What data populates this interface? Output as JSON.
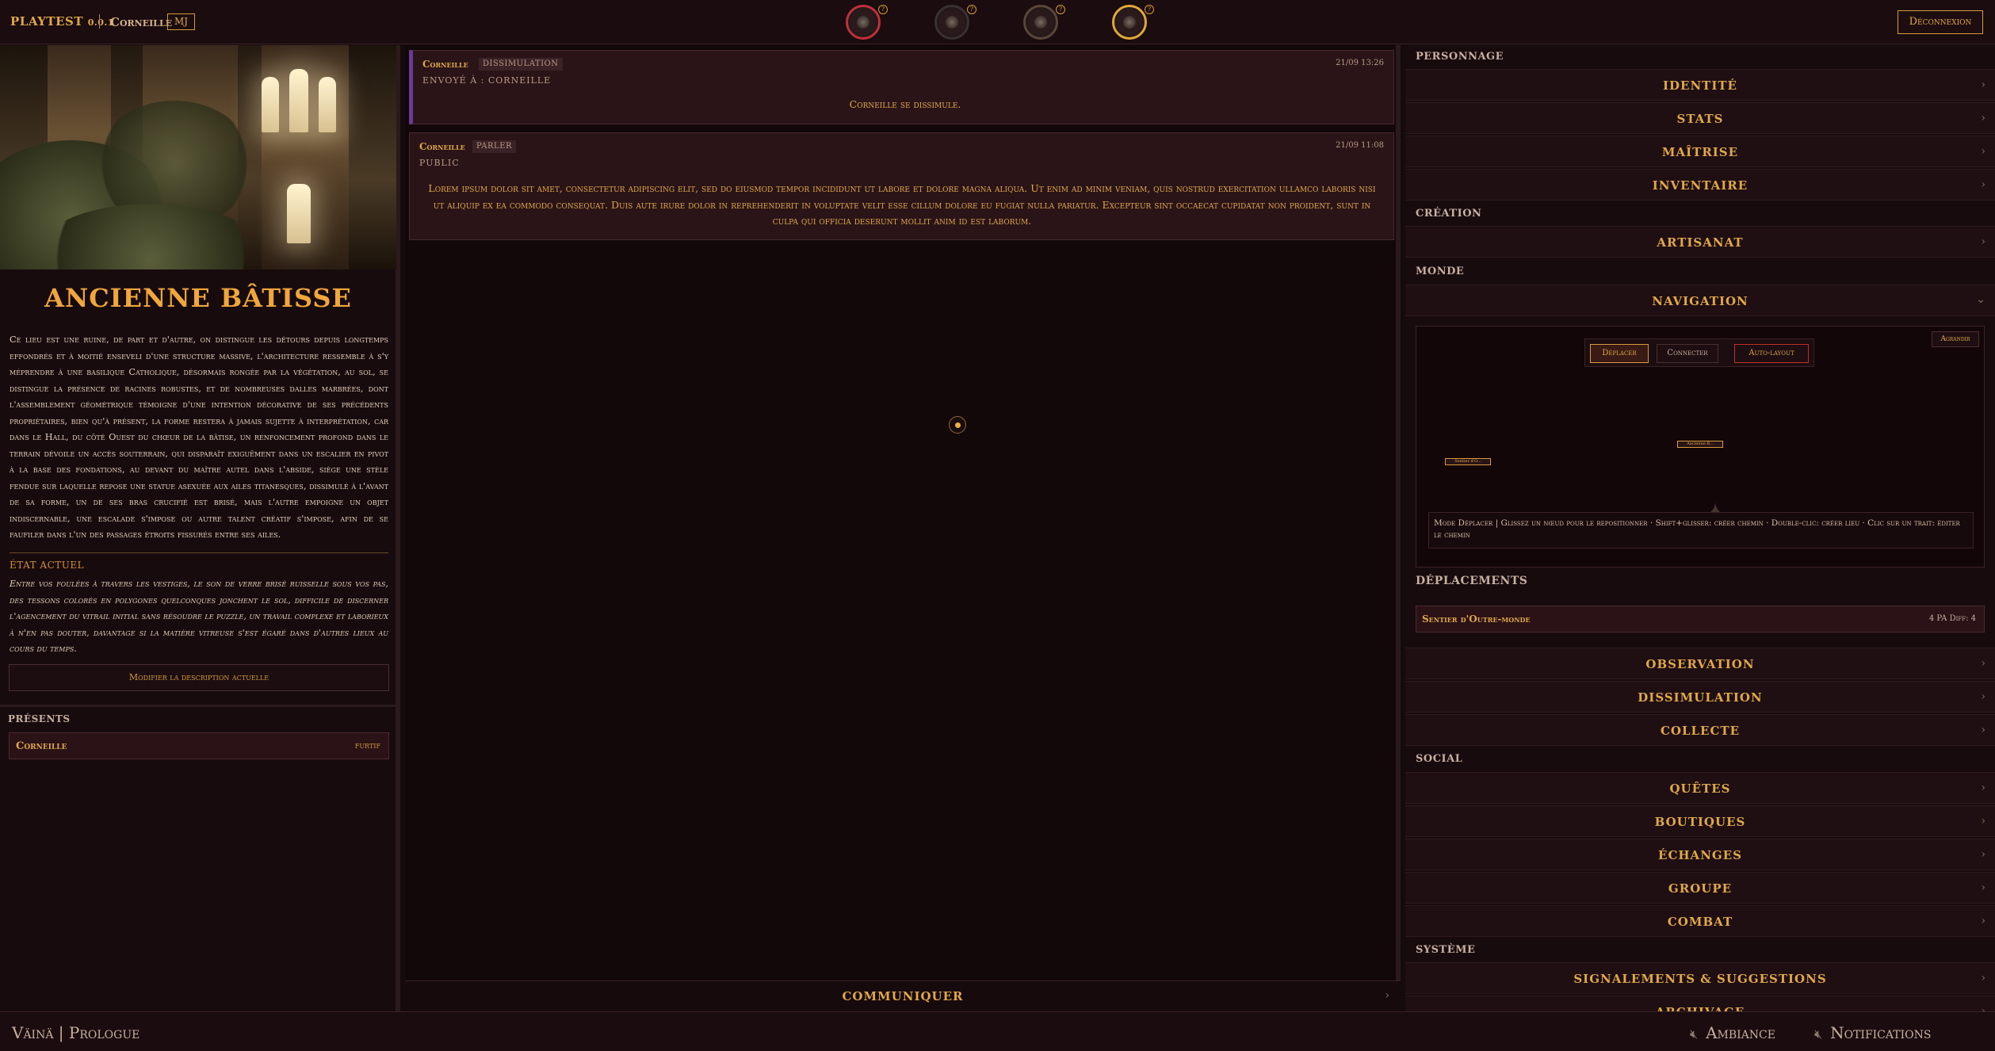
{
  "topbar": {
    "brand": "PLAYTEST",
    "version": "0.0.1",
    "user": "Corneille",
    "role_badge": "MJ",
    "logout_label": "Déconnexion",
    "status_rings": [
      {
        "name": "health-ring",
        "color": "#c0303a",
        "help": "?"
      },
      {
        "name": "stamina-ring",
        "color": "#4a4040",
        "help": "?"
      },
      {
        "name": "spirit-ring",
        "color": "#6a5040",
        "help": "?"
      },
      {
        "name": "perception-ring",
        "color": "#e0a83a",
        "help": "?"
      }
    ]
  },
  "location": {
    "title": "ANCIENNE BÂTISSE",
    "description": "Ce lieu est une ruine, de part et d'autre, on distingue les détours depuis longtemps effondrés et à moitié enseveli d'une structure massive, l'architecture ressemble à s'y méprendre à une basilique Catholique, désormais rongée par la végétation, au sol, se distingue la présence de racines robustes, et de nombreuses dalles marbrées, dont l'assemblement géométrique témoigne d'une intention décorative de ses précédents propriétaires, bien qu'à présent, la forme restera à jamais sujette à interprétation, car dans le Hall, du côté Ouest du chœur de la bâtise, un renfoncement profond dans le terrain dévoile un accès souterrain, qui disparaît exiguëment dans un escalier en pivot à la base des fondations, au devant du maître autel dans l'abside, siège une stèle fendue sur laquelle repose une statue asexuée aux ailes titanesques, dissimulé à l'avant de sa forme, un de ses bras crucifié est brisé, mais l'autre empoigne un objet indiscernable, une escalade s'impose ou autre talent créatif s'impose, afin de se faufiler dans l'un des passages étroits fissurés entre ses ailes.",
    "state_heading": "ÉTAT ACTUEL",
    "state_description": "Entre vos foulées à travers les vestiges, le son de verre brisé ruisselle sous vos pas, des tessons colorés en polygones quelconques jonchent le sol, difficile de discerner l'agencement du vitrail initial sans résoudre le puzzle, un travail complexe et laborieux à n'en pas douter, davantage si la matière vitreuse s'est égaré dans d'autres lieux au cours du temps.",
    "edit_label": "Modifier la description actuelle"
  },
  "present": {
    "heading": "PRÉSENTS",
    "players": [
      {
        "name": "Corneille",
        "status": "furtif"
      }
    ]
  },
  "messages": [
    {
      "author": "Corneille",
      "tag": "DISSIMULATION",
      "time": "21/09 13:26",
      "recipient": "ENVOYÉ À : CORNEILLE",
      "text": "Corneille se dissimule."
    },
    {
      "author": "Corneille",
      "tag": "PARLER",
      "time": "21/09 11:08",
      "recipient": "PUBLIC",
      "text": "Lorem ipsum dolor sit amet, consectetur adipiscing elit, sed do eiusmod tempor incididunt ut labore et dolore magna aliqua. Ut enim ad minim veniam, quis nostrud exercitation ullamco laboris nisi ut aliquip ex ea commodo consequat. Duis aute irure dolor in reprehenderit in voluptate velit esse cillum dolore eu fugiat nulla pariatur. Excepteur sint occaecat cupidatat non proident, sunt in culpa qui officia deserunt mollit anim id est laborum."
    }
  ],
  "communicate_label": "COMMUNIQUER",
  "sidebar": {
    "character_heading": "PERSONNAGE",
    "character_items": [
      "IDENTITÉ",
      "STATS",
      "MAÎTRISE",
      "INVENTAIRE"
    ],
    "creation_heading": "CRÉATION",
    "creation_items": [
      "ARTISANAT"
    ],
    "world_heading": "MONDE",
    "navigation_label": "NAVIGATION",
    "nav_tools": {
      "move": "Déplacer",
      "connect": "Connecter",
      "autolayout": "Auto-layout",
      "enlarge": "Agrandir"
    },
    "nav_nodes": [
      "Sentier d'O...",
      "Ancienne B..."
    ],
    "nav_help": "Mode Déplacer | Glissez un nœud pour le repositionner · Shift+glisser: créer chemin · Double-clic: créer lieu · Clic sur un trait: éditer le chemin",
    "moves_heading": "DÉPLACEMENTS",
    "move": {
      "name": "Sentier d'Outre-monde",
      "cost": "4 PA  Diff: 4"
    },
    "world_items": [
      "OBSERVATION",
      "DISSIMULATION",
      "COLLECTE"
    ],
    "social_heading": "SOCIAL",
    "social_items": [
      "QUÊTES",
      "BOUTIQUES",
      "ÉCHANGES",
      "GROUPE",
      "COMBAT"
    ],
    "system_heading": "SYSTÈME",
    "system_items": [
      "SIGNALEMENTS & SUGGESTIONS",
      "ARCHIVAGE"
    ]
  },
  "footer": {
    "title": "Väinä | Prologue",
    "ambiance_label": "Ambiance",
    "notifications_label": "Notifications"
  }
}
